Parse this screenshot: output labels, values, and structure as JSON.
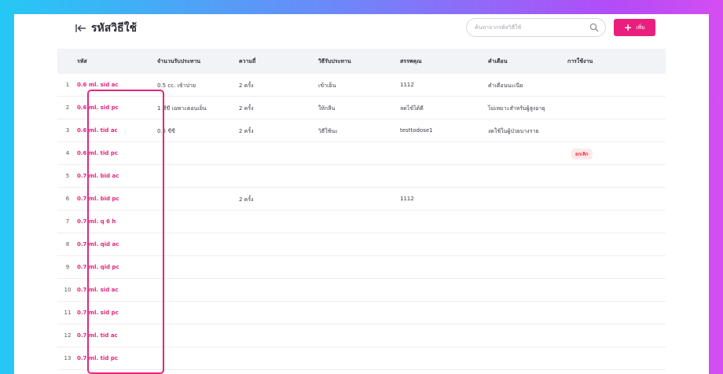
{
  "header": {
    "title": "รหัสวิธีใช้",
    "search_placeholder": "ค้นหาจากรหัสวิธีใช้",
    "add_label": "เพิ่ม"
  },
  "table": {
    "columns": [
      "รหัส",
      "จำนวนรับประทาน",
      "ความถี่",
      "วิธีรับประทาน",
      "สรรพคุณ",
      "คำเตือน",
      "การใช้งาน"
    ],
    "rows": [
      {
        "num": "1",
        "code": "0.6 ml. sid ac",
        "amount": "0.5 cc. เข้าปาย",
        "freq": "2 ครั้ง",
        "method": "เข้าเย็น",
        "benefit": "1112",
        "warning": "คำเตือนนะเนีย",
        "status": ""
      },
      {
        "num": "2",
        "code": "0.6 ml. sid pc",
        "amount": "1 ซีขี เฉพาะตอนเย็น",
        "freq": "2 ครั้ง",
        "method": "ให้กลืน",
        "benefit": "ลดไข้ได้ดี",
        "warning": "ไม่เหมาะสำหรับผู้สูงอายุ",
        "status": ""
      },
      {
        "num": "3",
        "code": "0.6 ml. tid ac",
        "amount": "0.5 ขีขี",
        "freq": "2 ครั้ง",
        "method": "วิธีใช้นะ",
        "benefit": "testtodose1",
        "warning": "งดใช้ในผู้ป่วยบางราย",
        "status": ""
      },
      {
        "num": "4",
        "code": "0.6 ml. tid pc",
        "amount": "",
        "freq": "",
        "method": "",
        "benefit": "",
        "warning": "",
        "status": "ยกเลิก"
      },
      {
        "num": "5",
        "code": "0.7 ml. bid ac",
        "amount": "",
        "freq": "",
        "method": "",
        "benefit": "",
        "warning": "",
        "status": ""
      },
      {
        "num": "6",
        "code": "0.7 ml. bid pc",
        "amount": "",
        "freq": "2 ครั้ง",
        "method": "",
        "benefit": "1112",
        "warning": "",
        "status": ""
      },
      {
        "num": "7",
        "code": "0.7 ml. q 6 h",
        "amount": "",
        "freq": "",
        "method": "",
        "benefit": "",
        "warning": "",
        "status": ""
      },
      {
        "num": "8",
        "code": "0.7 ml. qid ac",
        "amount": "",
        "freq": "",
        "method": "",
        "benefit": "",
        "warning": "",
        "status": ""
      },
      {
        "num": "9",
        "code": "0.7 ml. qid pc",
        "amount": "",
        "freq": "",
        "method": "",
        "benefit": "",
        "warning": "",
        "status": ""
      },
      {
        "num": "10",
        "code": "0.7 ml. sid ac",
        "amount": "",
        "freq": "",
        "method": "",
        "benefit": "",
        "warning": "",
        "status": ""
      },
      {
        "num": "11",
        "code": "0.7 ml. sid pc",
        "amount": "",
        "freq": "",
        "method": "",
        "benefit": "",
        "warning": "",
        "status": ""
      },
      {
        "num": "12",
        "code": "0.7 ml. tid ac",
        "amount": "",
        "freq": "",
        "method": "",
        "benefit": "",
        "warning": "",
        "status": ""
      },
      {
        "num": "13",
        "code": "0.7 ml. tid pc",
        "amount": "",
        "freq": "",
        "method": "",
        "benefit": "",
        "warning": "",
        "status": ""
      }
    ]
  },
  "colors": {
    "accent": "#ea1f7d",
    "code_text": "#e3267c",
    "badge_text": "#e2353f"
  }
}
